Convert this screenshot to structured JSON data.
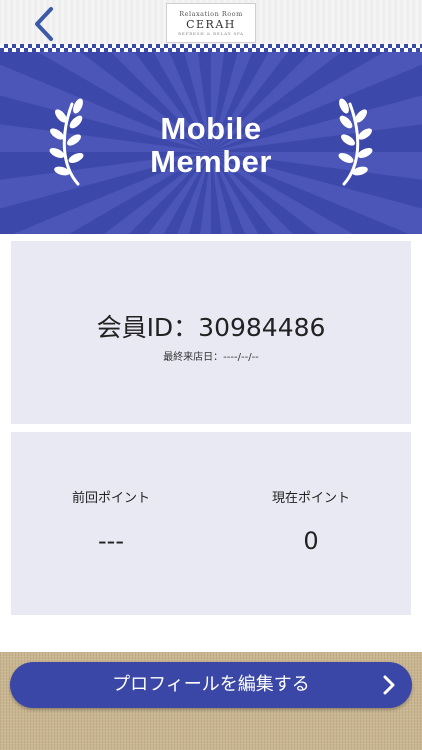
{
  "header": {
    "back_icon": "chevron-left-icon",
    "logo": {
      "subtitle": "Relaxation Room",
      "name": "CERAH",
      "tagline": "REFRESH & RELAX SPA"
    }
  },
  "banner": {
    "title_line1": "Mobile",
    "title_line2": "Member",
    "icon": "laurel-icon"
  },
  "member": {
    "id_text": "会員ID：30984486",
    "last_visit": "最終来店日：----/--/--"
  },
  "points": {
    "previous_label": "前回ポイント",
    "previous_value": "---",
    "current_label": "現在ポイント",
    "current_value": "0"
  },
  "footer": {
    "edit_button_label": "プロフィールを編集する",
    "edit_button_icon": "chevron-right-icon"
  },
  "colors": {
    "accent": "#3a47a6",
    "card_bg": "#e9e9f3",
    "back_icon": "#3a5aa8"
  }
}
